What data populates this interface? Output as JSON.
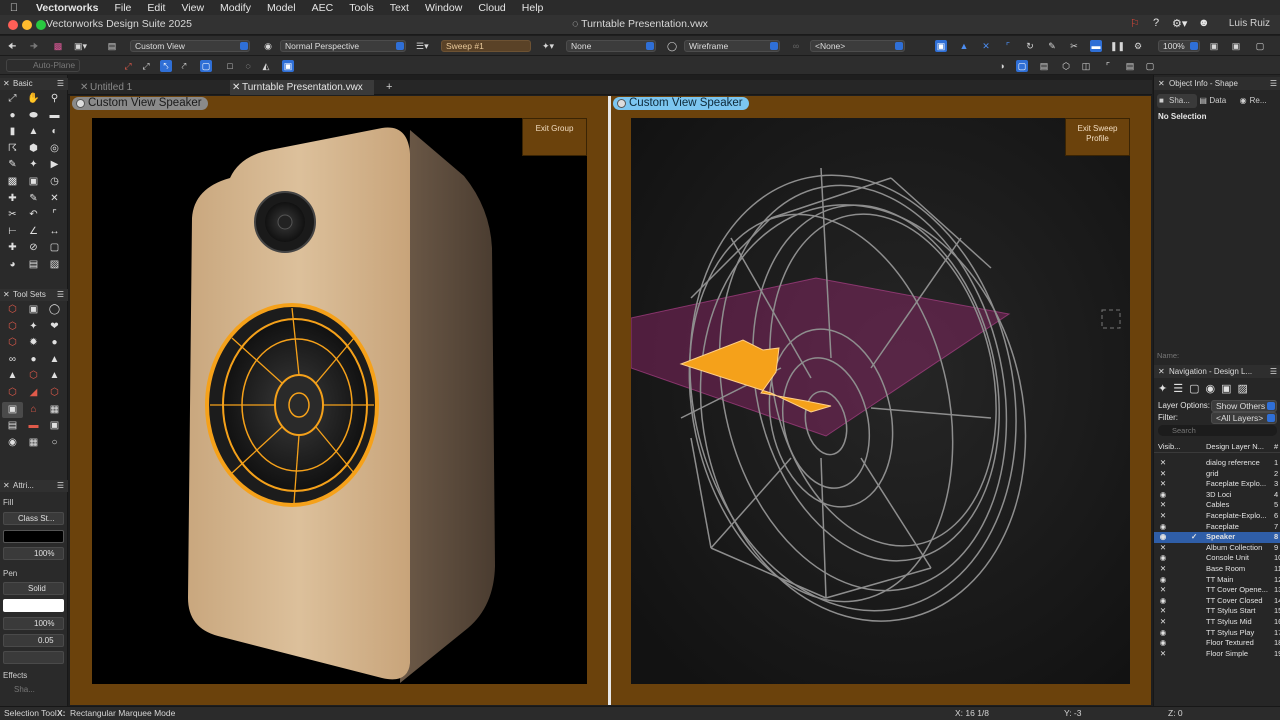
{
  "menubar": {
    "app_name": "Vectorworks",
    "items": [
      "File",
      "Edit",
      "View",
      "Modify",
      "Model",
      "AEC",
      "Tools",
      "Text",
      "Window",
      "Cloud",
      "Help"
    ]
  },
  "titlebar": {
    "app_title": "Vectorworks Design Suite 2025",
    "document_title": "Turntable Presentation.vwx",
    "user_name": "Luis Ruiz"
  },
  "view_bar": {
    "saved_view": "Custom View",
    "projection": "Normal Perspective",
    "layer": "Sweep #1",
    "class": "None",
    "render_mode": "Wireframe",
    "view_option": "<None>",
    "zoom": "100%"
  },
  "mode_bar": {
    "auto_plane": "Auto-Plane"
  },
  "doc_tabs": [
    {
      "label": "Untitled 1",
      "active": false
    },
    {
      "label": "Turntable Presentation.vwx",
      "active": true
    }
  ],
  "left_palettes": {
    "basic_title": "Basic",
    "toolsets_title": "Tool Sets",
    "attributes_title": "Attri...",
    "fill_label": "Fill",
    "fill_style": "Class St...",
    "fill_opacity": "100%",
    "pen_label": "Pen",
    "pen_style": "Solid",
    "pen_opacity": "100%",
    "line_weight": "0.05",
    "effects_label": "Effects",
    "shadow_label": "Sha..."
  },
  "viewports": {
    "left": {
      "label": "Custom View  Speaker",
      "exit_button": "Exit Group"
    },
    "right": {
      "label": "Custom View  Speaker",
      "exit_button": "Exit Sweep Profile"
    }
  },
  "object_info": {
    "title": "Object Info - Shape",
    "tabs": [
      "Sha...",
      "Data",
      "Re..."
    ],
    "selection": "No Selection",
    "name_label": "Name:"
  },
  "navigation": {
    "title": "Navigation - Design L...",
    "layer_options_label": "Layer Options:",
    "layer_options_value": "Show Others",
    "filter_label": "Filter:",
    "filter_value": "<All Layers>",
    "search_placeholder": "Search",
    "col_visibility": "Visib...",
    "col_name": "Design Layer N...",
    "col_number": "#",
    "layers": [
      {
        "name": "dialog reference",
        "num": "1",
        "vis": "x"
      },
      {
        "name": "grid",
        "num": "2",
        "vis": "x"
      },
      {
        "name": "Faceplate Explo...",
        "num": "3",
        "vis": "x"
      },
      {
        "name": "3D Loci",
        "num": "4",
        "vis": "eye"
      },
      {
        "name": "Cables",
        "num": "5",
        "vis": "x"
      },
      {
        "name": "Faceplate-Explo...",
        "num": "6",
        "vis": "x"
      },
      {
        "name": "Faceplate",
        "num": "7",
        "vis": "eye"
      },
      {
        "name": "Speaker",
        "num": "8",
        "vis": "eye",
        "active": true
      },
      {
        "name": "Album Collection",
        "num": "9",
        "vis": "x"
      },
      {
        "name": "Console Unit",
        "num": "10",
        "vis": "eye"
      },
      {
        "name": "Base Room",
        "num": "11",
        "vis": "x"
      },
      {
        "name": "TT Main",
        "num": "12",
        "vis": "eye"
      },
      {
        "name": "TT Cover Opene...",
        "num": "13",
        "vis": "x"
      },
      {
        "name": "TT Cover Closed",
        "num": "14",
        "vis": "eye"
      },
      {
        "name": "TT Stylus Start",
        "num": "15",
        "vis": "x"
      },
      {
        "name": "TT Stylus Mid",
        "num": "16",
        "vis": "x"
      },
      {
        "name": "TT Stylus Play",
        "num": "17",
        "vis": "eye"
      },
      {
        "name": "Floor Textured",
        "num": "18",
        "vis": "eye"
      },
      {
        "name": "Floor Simple",
        "num": "19",
        "vis": "x"
      }
    ]
  },
  "statusbar": {
    "tool": "Selection Tool",
    "mode_key": "X:",
    "mode": "Rectangular Marquee Mode",
    "x": "X: 16 1/8",
    "y": "Y: -3",
    "z": "Z: 0"
  },
  "colors": {
    "accent": "#2f6fd6",
    "viewport_frame": "#6b420c",
    "selection_orange": "#f5a11a",
    "active_viewport_label": "#7cc6f0"
  }
}
